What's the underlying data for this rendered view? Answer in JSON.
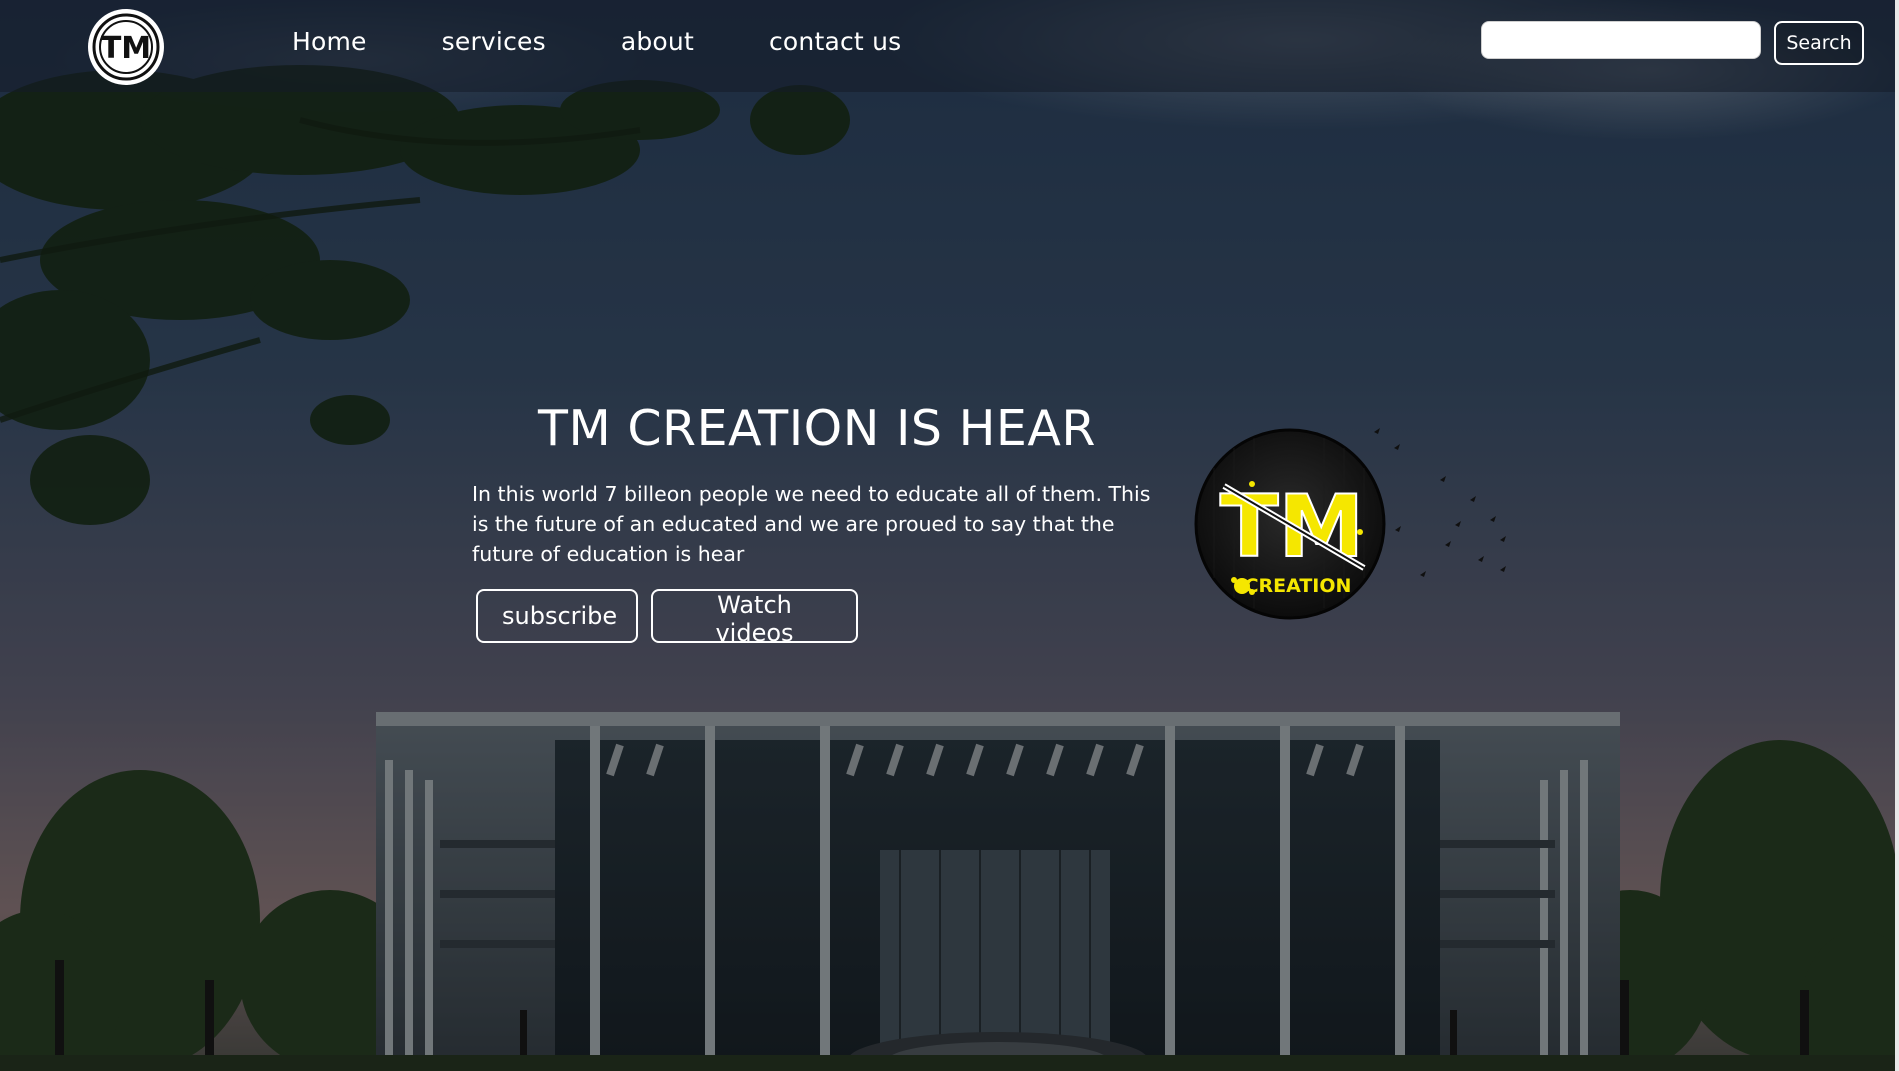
{
  "brand": {
    "logo_icon": "tm-logo-icon",
    "logo_text": "TM"
  },
  "nav": {
    "items": [
      {
        "label": "Home"
      },
      {
        "label": "services"
      },
      {
        "label": "about"
      },
      {
        "label": "contact us"
      }
    ]
  },
  "search": {
    "value": "",
    "button_label": "Search"
  },
  "hero": {
    "title": "TM CREATION IS HEAR",
    "text": "In this world 7 billeon people we need to educate all of them. This is the future of an educated and we are proued to say that the future of education is hear",
    "buttons": {
      "subscribe": "subscribe",
      "watch": "Watch videos"
    },
    "logo_icon": "tm-creation-logo-icon",
    "logo_main_text": "TM",
    "logo_sub_text": "CREATION"
  },
  "colors": {
    "accent_yellow": "#f5e700",
    "white": "#ffffff",
    "sky_top": "#3a4d66",
    "sky_bottom": "#7a6b70"
  }
}
